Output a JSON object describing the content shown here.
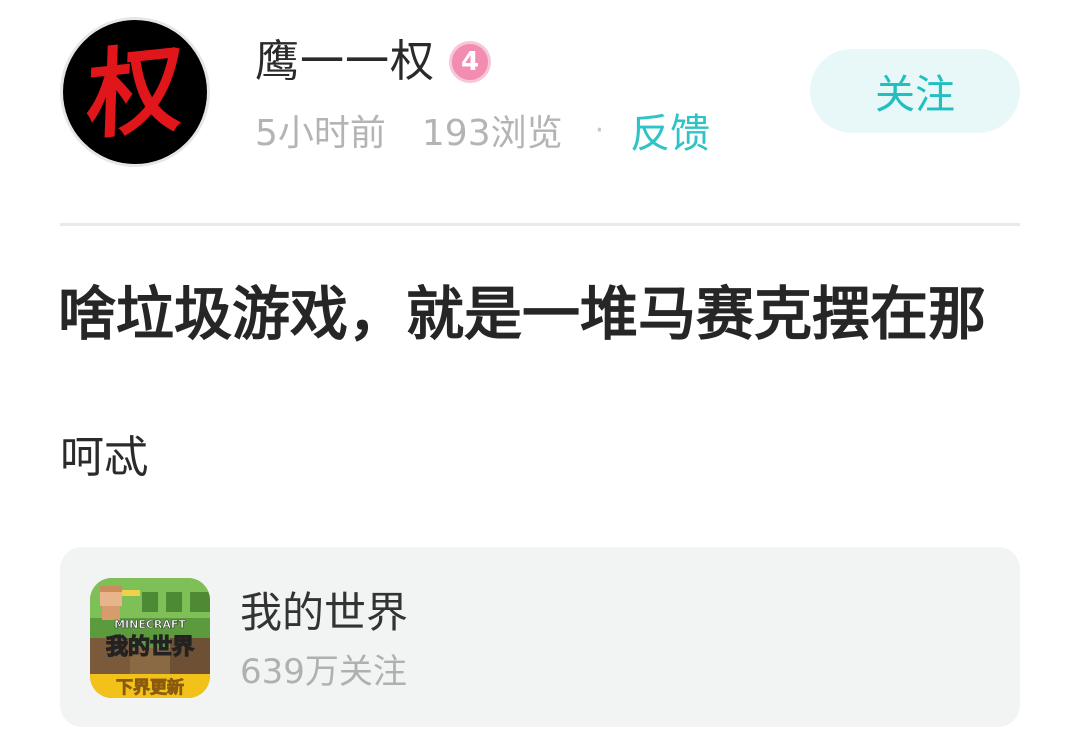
{
  "author": {
    "avatar_char": "权",
    "name": "鹰一一权",
    "level": "4",
    "time": "5小时前",
    "views": "193浏览",
    "separator": "·",
    "feedback_label": "反馈",
    "follow_label": "关注"
  },
  "post": {
    "title": "啥垃圾游戏，就是一堆马赛克摆在那",
    "body": "呵忒"
  },
  "game": {
    "name": "我的世界",
    "followers": "639万关注",
    "icon_logo_text": "MINECRAFT",
    "icon_title_text": "我的世界",
    "icon_banner_text": "下界更新"
  },
  "colors": {
    "accent": "#22bfc2",
    "follow_bg": "#e8f8f8",
    "badge": "#f28cb0",
    "card_bg": "#f2f4f4",
    "avatar_glyph": "#e0161b"
  }
}
